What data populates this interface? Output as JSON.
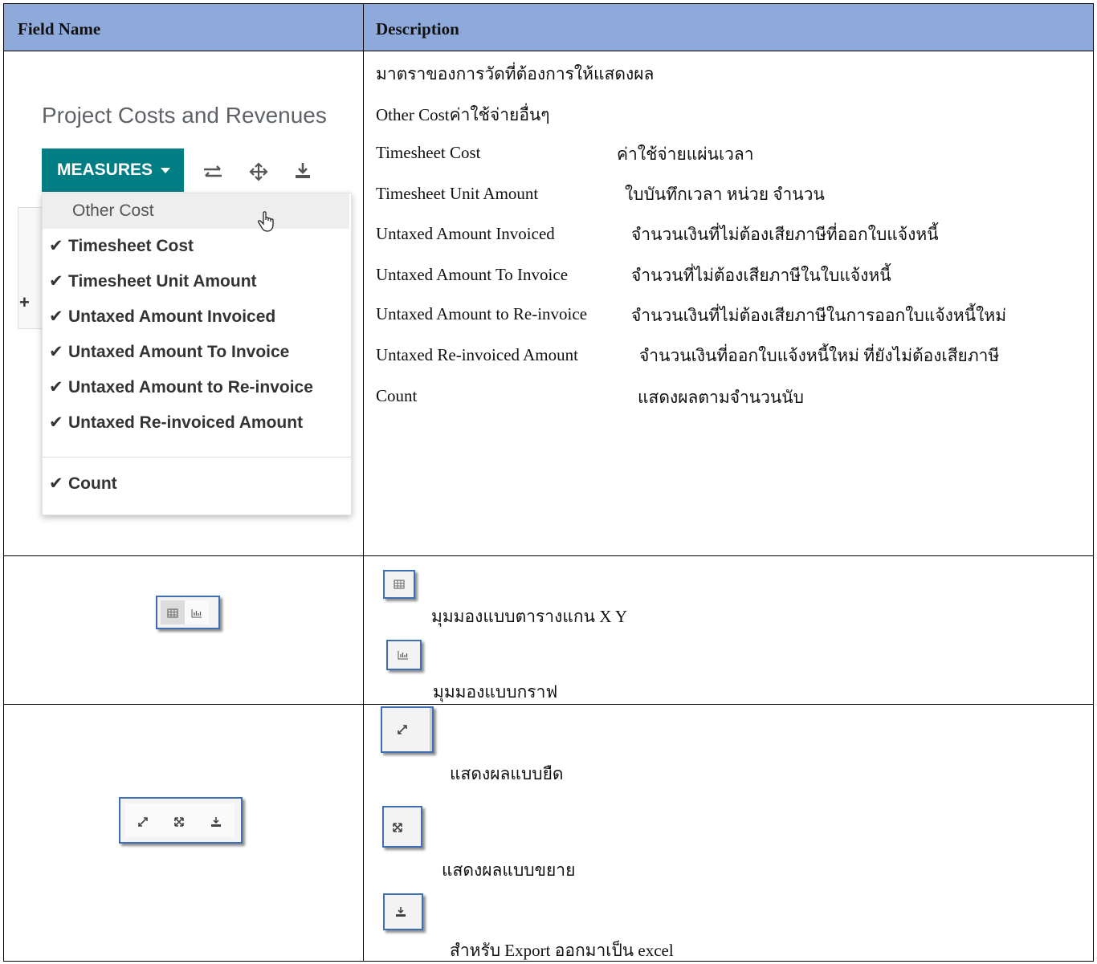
{
  "header": {
    "field_name": "Field Name",
    "description": "Description"
  },
  "measures_shot": {
    "title": "Project Costs and Revenues",
    "button_label": "MEASURES",
    "items": [
      {
        "label": "Other Cost",
        "checked": false
      },
      {
        "label": "Timesheet Cost",
        "checked": true
      },
      {
        "label": "Timesheet Unit Amount",
        "checked": true
      },
      {
        "label": "Untaxed Amount Invoiced",
        "checked": true
      },
      {
        "label": "Untaxed Amount To Invoice",
        "checked": true
      },
      {
        "label": "Untaxed Amount to Re-invoice",
        "checked": true
      },
      {
        "label": "Untaxed Re-invoiced Amount",
        "checked": true
      },
      {
        "label": "Count",
        "checked": true
      }
    ]
  },
  "measures_desc": {
    "intro": "มาตราของการวัดที่ต้องการให้แสดงผล",
    "other_cost": "Other Costค่าใช้จ่ายอื่นๆ",
    "rows": [
      {
        "name": "Timesheet Cost",
        "desc": "ค่าใช้จ่ายแผ่นเวลา"
      },
      {
        "name": "Timesheet Unit Amount",
        "desc": "ใบบันทึกเวลา หน่วย จำนวน"
      },
      {
        "name": "Untaxed Amount Invoiced",
        "desc": "จำนวนเงินที่ไม่ต้องเสียภาษีที่ออกใบแจ้งหนี้"
      },
      {
        "name": "Untaxed Amount To Invoice",
        "desc": "จำนวนที่ไม่ต้องเสียภาษีในใบแจ้งหนี้"
      },
      {
        "name": "Untaxed Amount to Re-invoice",
        "desc": "จำนวนเงินที่ไม่ต้องเสียภาษีในการออกใบแจ้งหนี้ใหม่"
      },
      {
        "name": "Untaxed Re-invoiced Amount",
        "desc": "จำนวนเงินที่ออกใบแจ้งหนี้ใหม่ ที่ยังไม่ต้องเสียภาษี"
      },
      {
        "name": "Count",
        "desc": "แสดงผลตามจำนวนนับ"
      }
    ]
  },
  "view_desc": {
    "table_view": "มุมมองแบบตารางแกน X Y",
    "graph_view": "มุมมองแบบกราฟ"
  },
  "tool_desc": {
    "flip": "แสดงผลแบบยืด",
    "expand": "แสดงผลแบบขยาย",
    "download": "สำหรับ Export ออกมาเป็น excel"
  },
  "icons": [
    "table-view-icon",
    "graph-view-icon",
    "flip-axis-icon",
    "expand-all-icon",
    "download-icon",
    "swap-icon",
    "move-icon",
    "hand-cursor-icon",
    "check-icon",
    "caret-down-icon"
  ],
  "colors": {
    "header_bg": "#8eaadb",
    "button_bg": "#017e84",
    "frame_border": "#3e6fb5"
  }
}
